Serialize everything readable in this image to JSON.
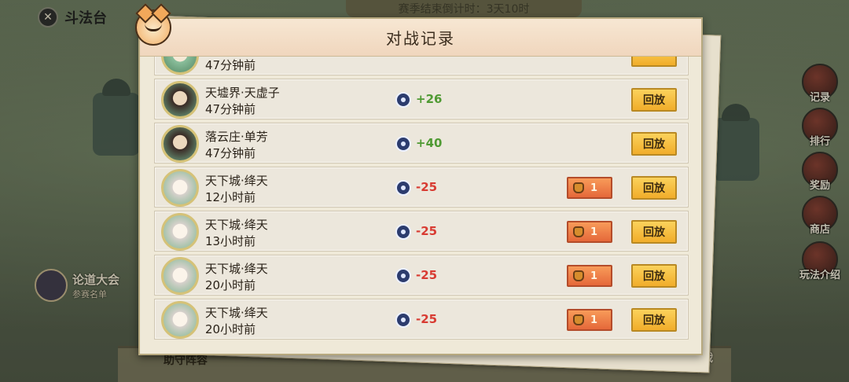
{
  "topbar": {
    "title": "斗法台",
    "close_icon": "close-icon",
    "banner": "赛季结束倒计时：3天10时"
  },
  "dialog": {
    "title": "对战记录"
  },
  "records": [
    {
      "name": "",
      "time": "47分钟前",
      "score": "",
      "badge": "",
      "replay": "",
      "avatar": "green"
    },
    {
      "name": "天墟界·天虚子",
      "time": "47分钟前",
      "score": "+26",
      "badge": "",
      "replay": "回放",
      "avatar": "dark"
    },
    {
      "name": "落云庄·单芳",
      "time": "47分钟前",
      "score": "+40",
      "badge": "",
      "replay": "回放",
      "avatar": "dark"
    },
    {
      "name": "天下城·绛天",
      "time": "12小时前",
      "score": "-25",
      "badge": "1",
      "replay": "回放",
      "avatar": "light"
    },
    {
      "name": "天下城·绛天",
      "time": "13小时前",
      "score": "-25",
      "badge": "1",
      "replay": "回放",
      "avatar": "light"
    },
    {
      "name": "天下城·绛天",
      "time": "20小时前",
      "score": "-25",
      "badge": "1",
      "replay": "回放",
      "avatar": "light"
    },
    {
      "name": "天下城·绛天",
      "time": "20小时前",
      "score": "-25",
      "badge": "1",
      "replay": "回放",
      "avatar": "light"
    }
  ],
  "side_menu": [
    {
      "label": "记录",
      "icon": "record-icon"
    },
    {
      "label": "排行",
      "icon": "rank-icon"
    },
    {
      "label": "奖励",
      "icon": "reward-icon"
    },
    {
      "label": "商店",
      "icon": "shop-icon"
    },
    {
      "label": "玩法介绍",
      "icon": "guide-icon"
    }
  ],
  "left_event": {
    "title": "论道大会",
    "subtitle": "参赛名单"
  },
  "bottom": {
    "left_text": "助守阵容",
    "right_text": "战"
  }
}
